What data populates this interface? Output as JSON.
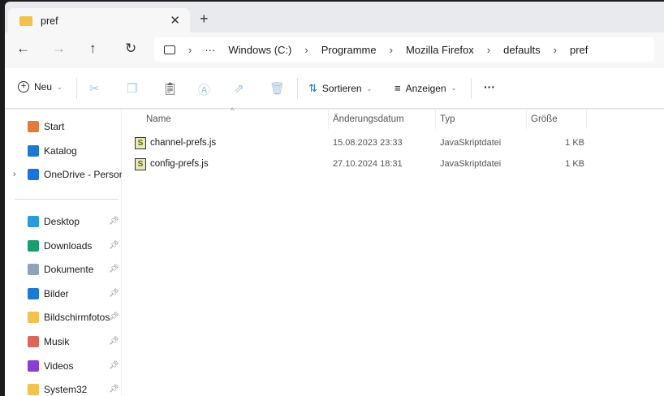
{
  "tab": {
    "title": "pref",
    "close": "✕",
    "new": "+"
  },
  "nav": {
    "back": "←",
    "forward": "→",
    "up": "↑",
    "refresh": "↻"
  },
  "breadcrumb": [
    "Windows (C:)",
    "Programme",
    "Mozilla Firefox",
    "defaults",
    "pref"
  ],
  "breadcrumb_more": "···",
  "toolbar": {
    "new_label": "Neu",
    "sort_label": "Sortieren",
    "view_label": "Anzeigen",
    "more": "···"
  },
  "sidebar": {
    "top": [
      {
        "label": "Start",
        "icon": "home-icon",
        "color": "#e07b39"
      },
      {
        "label": "Katalog",
        "icon": "gallery-icon",
        "color": "#1e78d0"
      },
      {
        "label": "OneDrive - Persona",
        "icon": "cloud-icon",
        "color": "#1a73d9"
      }
    ],
    "pinned": [
      {
        "label": "Desktop",
        "icon": "desktop-icon",
        "color": "#2a9bd8"
      },
      {
        "label": "Downloads",
        "icon": "download-icon",
        "color": "#1a9e6e"
      },
      {
        "label": "Dokumente",
        "icon": "document-icon",
        "color": "#8fa3b8"
      },
      {
        "label": "Bilder",
        "icon": "pictures-icon",
        "color": "#1e78d0"
      },
      {
        "label": "Bildschirmfotos",
        "icon": "folder-icon",
        "color": "#f2c14e"
      },
      {
        "label": "Musik",
        "icon": "music-icon",
        "color": "#d9685a"
      },
      {
        "label": "Videos",
        "icon": "video-icon",
        "color": "#8a3fd0"
      },
      {
        "label": "System32",
        "icon": "folder-icon",
        "color": "#f2c14e"
      }
    ]
  },
  "columns": [
    "Name",
    "Änderungsdatum",
    "Typ",
    "Größe"
  ],
  "files": [
    {
      "name": "channel-prefs.js",
      "date": "15.08.2023 23:33",
      "type": "JavaSkriptdatei",
      "size": "1 KB"
    },
    {
      "name": "config-prefs.js",
      "date": "27.10.2024 18:31",
      "type": "JavaSkriptdatei",
      "size": "1 KB"
    }
  ]
}
